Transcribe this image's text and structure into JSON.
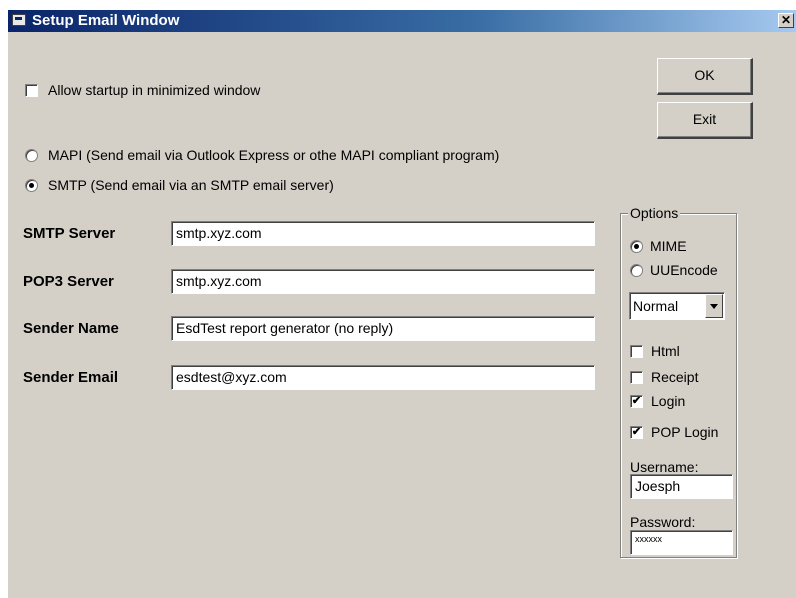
{
  "window": {
    "title": "Setup Email Window",
    "close_glyph": "✕"
  },
  "buttons": {
    "ok": "OK",
    "exit": "Exit"
  },
  "startup": {
    "label": "Allow startup in minimized window",
    "checked": false
  },
  "mode": {
    "mapi_label": "MAPI (Send email via Outlook Express or othe MAPI compliant program)",
    "smtp_label": "SMTP (Send email via an SMTP email server)",
    "selected": "smtp"
  },
  "fields": [
    {
      "label": "SMTP Server",
      "value": "smtp.xyz.com"
    },
    {
      "label": "POP3 Server",
      "value": "smtp.xyz.com"
    },
    {
      "label": "Sender Name",
      "value": "EsdTest report generator (no reply)"
    },
    {
      "label": "Sender Email",
      "value": "esdtest@xyz.com"
    }
  ],
  "options": {
    "title": "Options",
    "encoding": {
      "mime": "MIME",
      "uuencode": "UUEncode",
      "selected": "mime"
    },
    "priority": "Normal",
    "html": {
      "label": "Html",
      "checked": false
    },
    "receipt": {
      "label": "Receipt",
      "checked": false
    },
    "login": {
      "label": "Login",
      "checked": true
    },
    "pop_login": {
      "label": "POP Login",
      "checked": true
    },
    "username": {
      "label": "Username:",
      "value": "Joesph"
    },
    "password": {
      "label": "Password:",
      "value": "xxxxxx"
    }
  },
  "check_glyph": "✔"
}
